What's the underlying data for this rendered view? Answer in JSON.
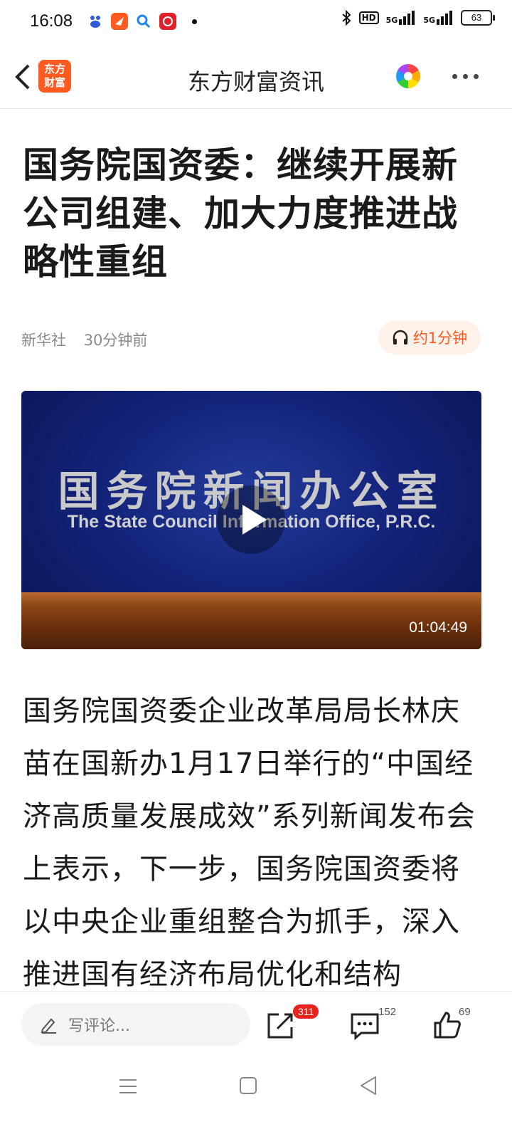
{
  "status_bar": {
    "time": "16:08",
    "app_icons": [
      "baidu-icon",
      "orange-app-icon",
      "search-app-icon",
      "red-app-icon"
    ],
    "network": [
      "HD",
      "5G",
      "5G"
    ],
    "battery": "63"
  },
  "nav": {
    "brand_logo_line1": "东方",
    "brand_logo_line2": "财富",
    "title": "东方财富资讯",
    "brand_color": "#ff5a1f"
  },
  "article": {
    "headline": "国务院国资委：继续开展新公司组建、加大力度推进战略性重组",
    "source": "新华社",
    "time_ago": "30分钟前",
    "listen_label": "约1分钟",
    "video": {
      "title_cn": "国务院新闻办公室",
      "title_en": "The State Council Information Office, P.R.C.",
      "duration": "01:04:49"
    },
    "body": "国务院国资委企业改革局局长林庆苗在国新办1月17日举行的“中国经济高质量发展成效”系列新闻发布会上表示，下一步，国务院国资委将以中央企业重组整合为抓手，深入推进国有经济布局优化和结构"
  },
  "bottom_bar": {
    "comment_placeholder": "写评论...",
    "share_count": "311",
    "comment_count": "152",
    "like_count": "69"
  }
}
